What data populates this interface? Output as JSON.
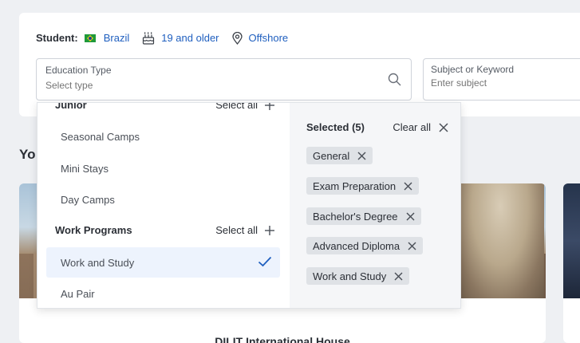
{
  "student": {
    "label": "Student:",
    "country": "Brazil",
    "age": "19 and older",
    "location": "Offshore"
  },
  "education_field": {
    "label": "Education Type",
    "placeholder": "Select type"
  },
  "subject_field": {
    "label": "Subject or Keyword",
    "placeholder": "Enter subject"
  },
  "section": {
    "heading": "Yo"
  },
  "card": {
    "title": "DILIT International House"
  },
  "dropdown": {
    "groups": [
      {
        "title": "Junior",
        "select_all": "Select all"
      },
      {
        "title": "Work Programs",
        "select_all": "Select all"
      }
    ],
    "options": [
      {
        "label": "Seasonal Camps",
        "selected": false
      },
      {
        "label": "Mini Stays",
        "selected": false
      },
      {
        "label": "Day Camps",
        "selected": false
      },
      {
        "label": "Work and Study",
        "selected": true
      },
      {
        "label": "Au Pair",
        "selected": false
      }
    ],
    "selected_panel": {
      "count_label": "Selected (5)",
      "clear_all": "Clear all",
      "chips": [
        "General",
        "Exam Preparation",
        "Bachelor's Degree",
        "Advanced Diploma",
        "Work and Study"
      ]
    }
  },
  "colors": {
    "link": "#1f5fbf",
    "selected_bg": "#edf3fd",
    "chip_bg": "#dfe2e6",
    "check": "#1f5fbf"
  }
}
